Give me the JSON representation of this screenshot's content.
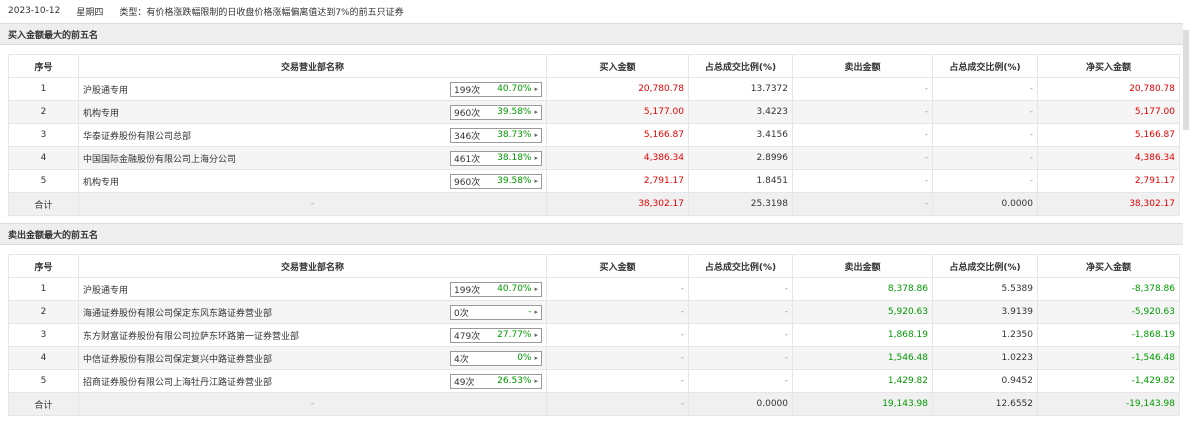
{
  "header": {
    "date": "2023-10-12",
    "weekday": "星期四",
    "type_text": "类型：有价格涨跌幅限制的日收盘价格涨幅偏离值达到7%的前五只证券"
  },
  "buy_section": {
    "title": "买入金额最大的前五名",
    "columns": [
      "序号",
      "交易营业部名称",
      "买入金额",
      "占总成交比例(%)",
      "卖出金额",
      "占总成交比例(%)",
      "净买入金额"
    ],
    "rows": [
      {
        "idx": "1",
        "name": "沪股通专用",
        "times": "199次",
        "pct": "40.70%",
        "buy": "20,780.78",
        "buy_ratio": "13.7372",
        "sell": "-",
        "sell_ratio": "-",
        "net": "20,780.78"
      },
      {
        "idx": "2",
        "name": "机构专用",
        "times": "960次",
        "pct": "39.58%",
        "buy": "5,177.00",
        "buy_ratio": "3.4223",
        "sell": "-",
        "sell_ratio": "-",
        "net": "5,177.00"
      },
      {
        "idx": "3",
        "name": "华泰证券股份有限公司总部",
        "times": "346次",
        "pct": "38.73%",
        "buy": "5,166.87",
        "buy_ratio": "3.4156",
        "sell": "-",
        "sell_ratio": "-",
        "net": "5,166.87"
      },
      {
        "idx": "4",
        "name": "中国国际金融股份有限公司上海分公司",
        "times": "461次",
        "pct": "38.18%",
        "buy": "4,386.34",
        "buy_ratio": "2.8996",
        "sell": "-",
        "sell_ratio": "-",
        "net": "4,386.34"
      },
      {
        "idx": "5",
        "name": "机构专用",
        "times": "960次",
        "pct": "39.58%",
        "buy": "2,791.17",
        "buy_ratio": "1.8451",
        "sell": "-",
        "sell_ratio": "-",
        "net": "2,791.17"
      }
    ],
    "total": {
      "label": "合计",
      "name": "-",
      "buy": "38,302.17",
      "buy_ratio": "25.3198",
      "sell": "-",
      "sell_ratio": "0.0000",
      "net": "38,302.17"
    }
  },
  "sell_section": {
    "title": "卖出金额最大的前五名",
    "columns": [
      "序号",
      "交易营业部名称",
      "买入金额",
      "占总成交比例(%)",
      "卖出金额",
      "占总成交比例(%)",
      "净买入金额"
    ],
    "rows": [
      {
        "idx": "1",
        "name": "沪股通专用",
        "times": "199次",
        "pct": "40.70%",
        "buy": "-",
        "buy_ratio": "-",
        "sell": "8,378.86",
        "sell_ratio": "5.5389",
        "net": "-8,378.86"
      },
      {
        "idx": "2",
        "name": "海通证券股份有限公司保定东风东路证券营业部",
        "times": "0次",
        "pct": "-",
        "buy": "-",
        "buy_ratio": "-",
        "sell": "5,920.63",
        "sell_ratio": "3.9139",
        "net": "-5,920.63"
      },
      {
        "idx": "3",
        "name": "东方财富证券股份有限公司拉萨东环路第一证券营业部",
        "times": "479次",
        "pct": "27.77%",
        "buy": "-",
        "buy_ratio": "-",
        "sell": "1,868.19",
        "sell_ratio": "1.2350",
        "net": "-1,868.19"
      },
      {
        "idx": "4",
        "name": "中信证券股份有限公司保定复兴中路证券营业部",
        "times": "4次",
        "pct": "0%",
        "buy": "-",
        "buy_ratio": "-",
        "sell": "1,546.48",
        "sell_ratio": "1.0223",
        "net": "-1,546.48"
      },
      {
        "idx": "5",
        "name": "招商证券股份有限公司上海牡丹江路证券营业部",
        "times": "49次",
        "pct": "26.53%",
        "buy": "-",
        "buy_ratio": "-",
        "sell": "1,429.82",
        "sell_ratio": "0.9452",
        "net": "-1,429.82"
      }
    ],
    "total": {
      "label": "合计",
      "name": "-",
      "buy": "-",
      "buy_ratio": "0.0000",
      "sell": "19,143.98",
      "sell_ratio": "12.6552",
      "net": "-19,143.98"
    }
  },
  "colors": {
    "positive": "#e60000",
    "negative": "#009900",
    "header_bg": "#eeeeee"
  }
}
